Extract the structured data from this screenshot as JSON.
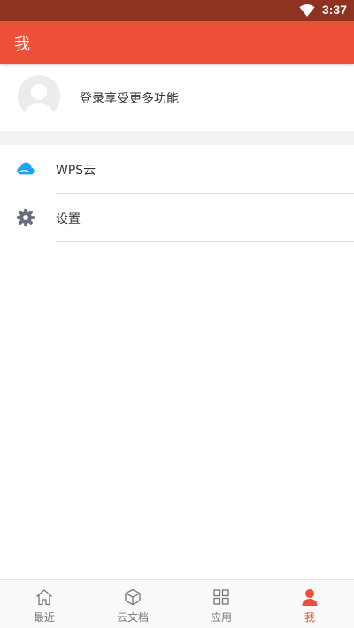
{
  "status_bar": {
    "time": "3:37"
  },
  "header": {
    "title": "我"
  },
  "profile": {
    "login_prompt": "登录享受更多功能"
  },
  "menu": [
    {
      "label": "WPS云",
      "icon": "cloud-icon",
      "icon_color": "#1aa3f5"
    },
    {
      "label": "设置",
      "icon": "gear-icon",
      "icon_color": "#656f80"
    }
  ],
  "bottom_nav": [
    {
      "label": "最近",
      "icon": "home-icon",
      "active": false
    },
    {
      "label": "云文档",
      "icon": "cube-icon",
      "active": false
    },
    {
      "label": "应用",
      "icon": "grid-icon",
      "active": false
    },
    {
      "label": "我",
      "icon": "person-icon",
      "active": true
    }
  ],
  "colors": {
    "accent": "#ec5039",
    "status_bar": "#8f3221",
    "inactive": "#777777"
  }
}
